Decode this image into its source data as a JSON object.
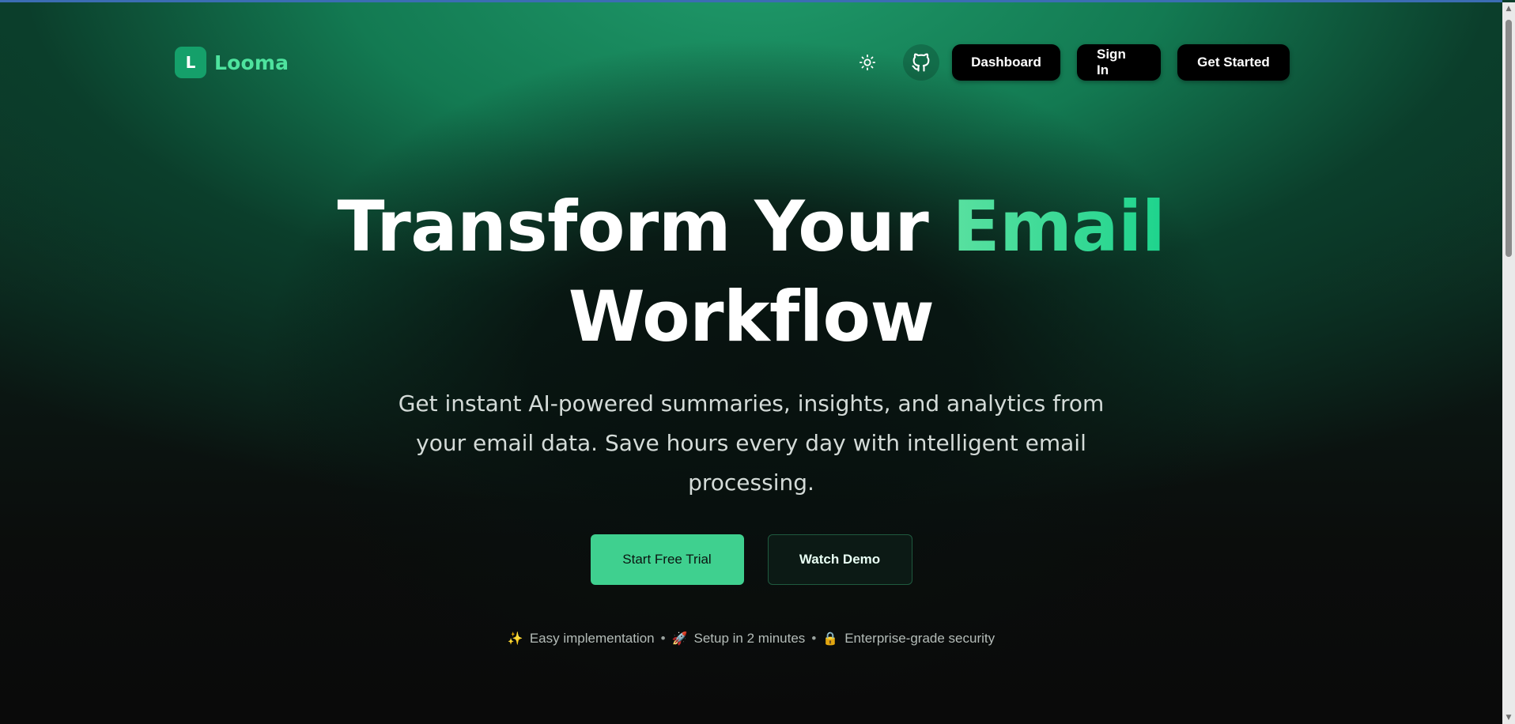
{
  "brand": {
    "mark": "L",
    "name": "Looma"
  },
  "nav": {
    "dashboard_label": "Dashboard",
    "signin_label": "Sign In",
    "get_started_label": "Get Started",
    "theme_icon": "sun-icon",
    "github_icon": "github-icon"
  },
  "hero": {
    "headline_part1": "Transform Your",
    "headline_accent": "Email",
    "headline_part2": "Workflow",
    "subtitle": "Get instant AI-powered summaries, insights, and analytics from your email data. Save hours every day with intelligent email processing.",
    "primary_cta": "Start Free Trial",
    "secondary_cta": "Watch Demo",
    "trust": [
      {
        "emoji": "✨",
        "text": "Easy implementation"
      },
      {
        "emoji": "🚀",
        "text": "Setup in 2 minutes"
      },
      {
        "emoji": "🔒",
        "text": "Enterprise-grade security"
      }
    ],
    "separator": "•"
  },
  "colors": {
    "accent": "#3fd08f",
    "brand_green": "#15a06a",
    "brand_text": "#4ee39e"
  }
}
